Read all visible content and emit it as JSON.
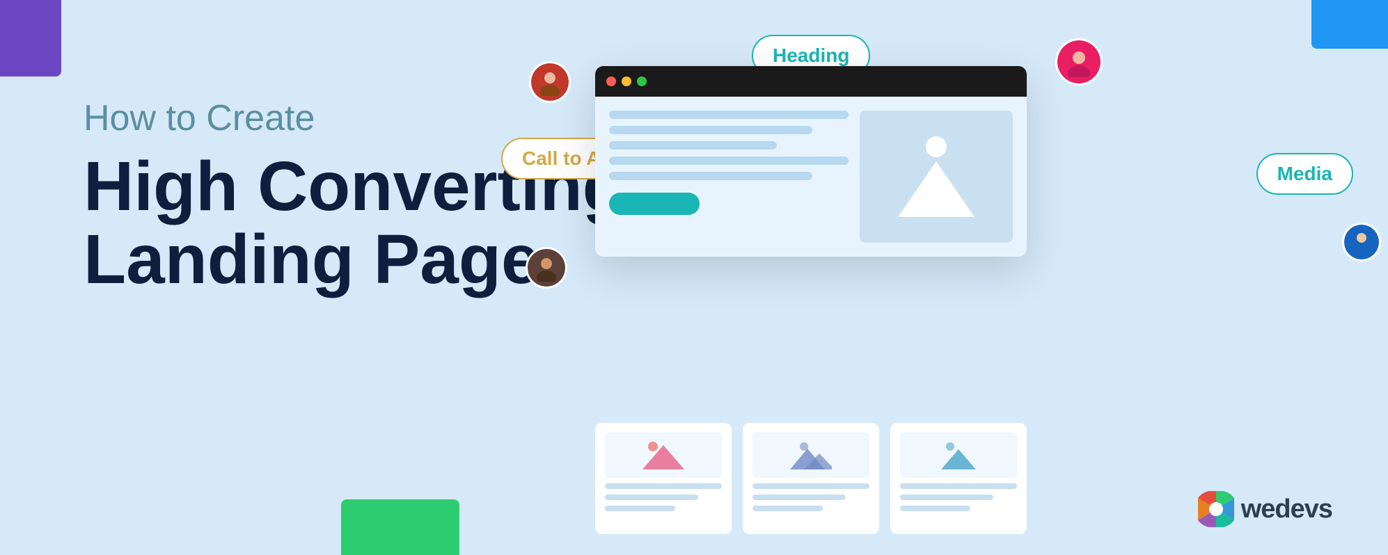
{
  "corners": {
    "purple": "purple-corner",
    "blue": "blue-corner",
    "green": "green-accent"
  },
  "left": {
    "subtitle": "How to Create",
    "title_line1": "High Converting",
    "title_line2": "Landing Page"
  },
  "badges": {
    "cta": "Call to Action",
    "heading": "Heading",
    "media": "Media"
  },
  "browser": {
    "dots": [
      "red",
      "yellow",
      "green"
    ],
    "cta_button": "button"
  },
  "cards": [
    {
      "color": "#e87fa0"
    },
    {
      "color": "#8b9fd4"
    },
    {
      "color": "#6ab4d4"
    }
  ],
  "logo": {
    "text": "wedevs"
  },
  "avatars": [
    {
      "id": "1",
      "color": "#c0392b"
    },
    {
      "id": "2",
      "color": "#5d4037"
    },
    {
      "id": "3",
      "color": "#e91e63"
    },
    {
      "id": "4",
      "color": "#1565c0"
    }
  ]
}
